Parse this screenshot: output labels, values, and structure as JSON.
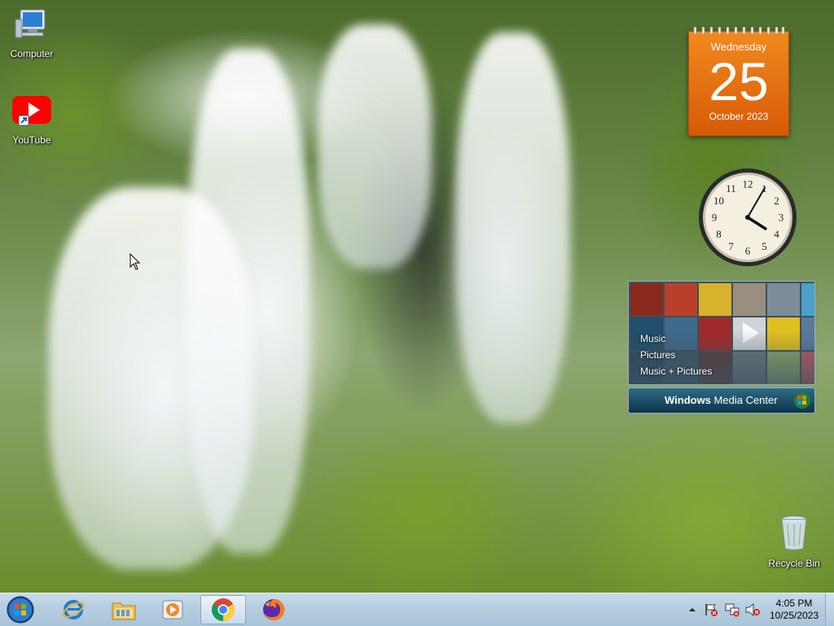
{
  "desktop": {
    "icons": [
      {
        "label": "Computer",
        "icon": "computer-icon"
      },
      {
        "label": "YouTube",
        "icon": "youtube-icon"
      },
      {
        "label": "Recycle Bin",
        "icon": "recycle-bin-icon"
      }
    ]
  },
  "calendar_gadget": {
    "weekday": "Wednesday",
    "day": "25",
    "month_year": "October 2023",
    "color": "#e8740f"
  },
  "clock_gadget": {
    "hour": 4,
    "minute": 5,
    "numerals": [
      "12",
      "1",
      "2",
      "3",
      "4",
      "5",
      "6",
      "7",
      "8",
      "9",
      "10",
      "11"
    ]
  },
  "media_center_gadget": {
    "menu": [
      "Music",
      "Pictures",
      "Music + Pictures"
    ],
    "brand_first": "Windows",
    "brand_second": " Media Center"
  },
  "taskbar": {
    "start": "start-orb-icon",
    "pinned": [
      {
        "name": "internet-explorer-icon"
      },
      {
        "name": "file-explorer-icon"
      },
      {
        "name": "media-player-icon"
      },
      {
        "name": "chrome-icon",
        "active": true
      },
      {
        "name": "firefox-icon"
      }
    ],
    "tray_icons": [
      "show-hidden-icons-chevron",
      "action-center-flag-icon",
      "network-icon",
      "volume-muted-icon"
    ],
    "time": "4:05 PM",
    "date": "10/25/2023"
  }
}
